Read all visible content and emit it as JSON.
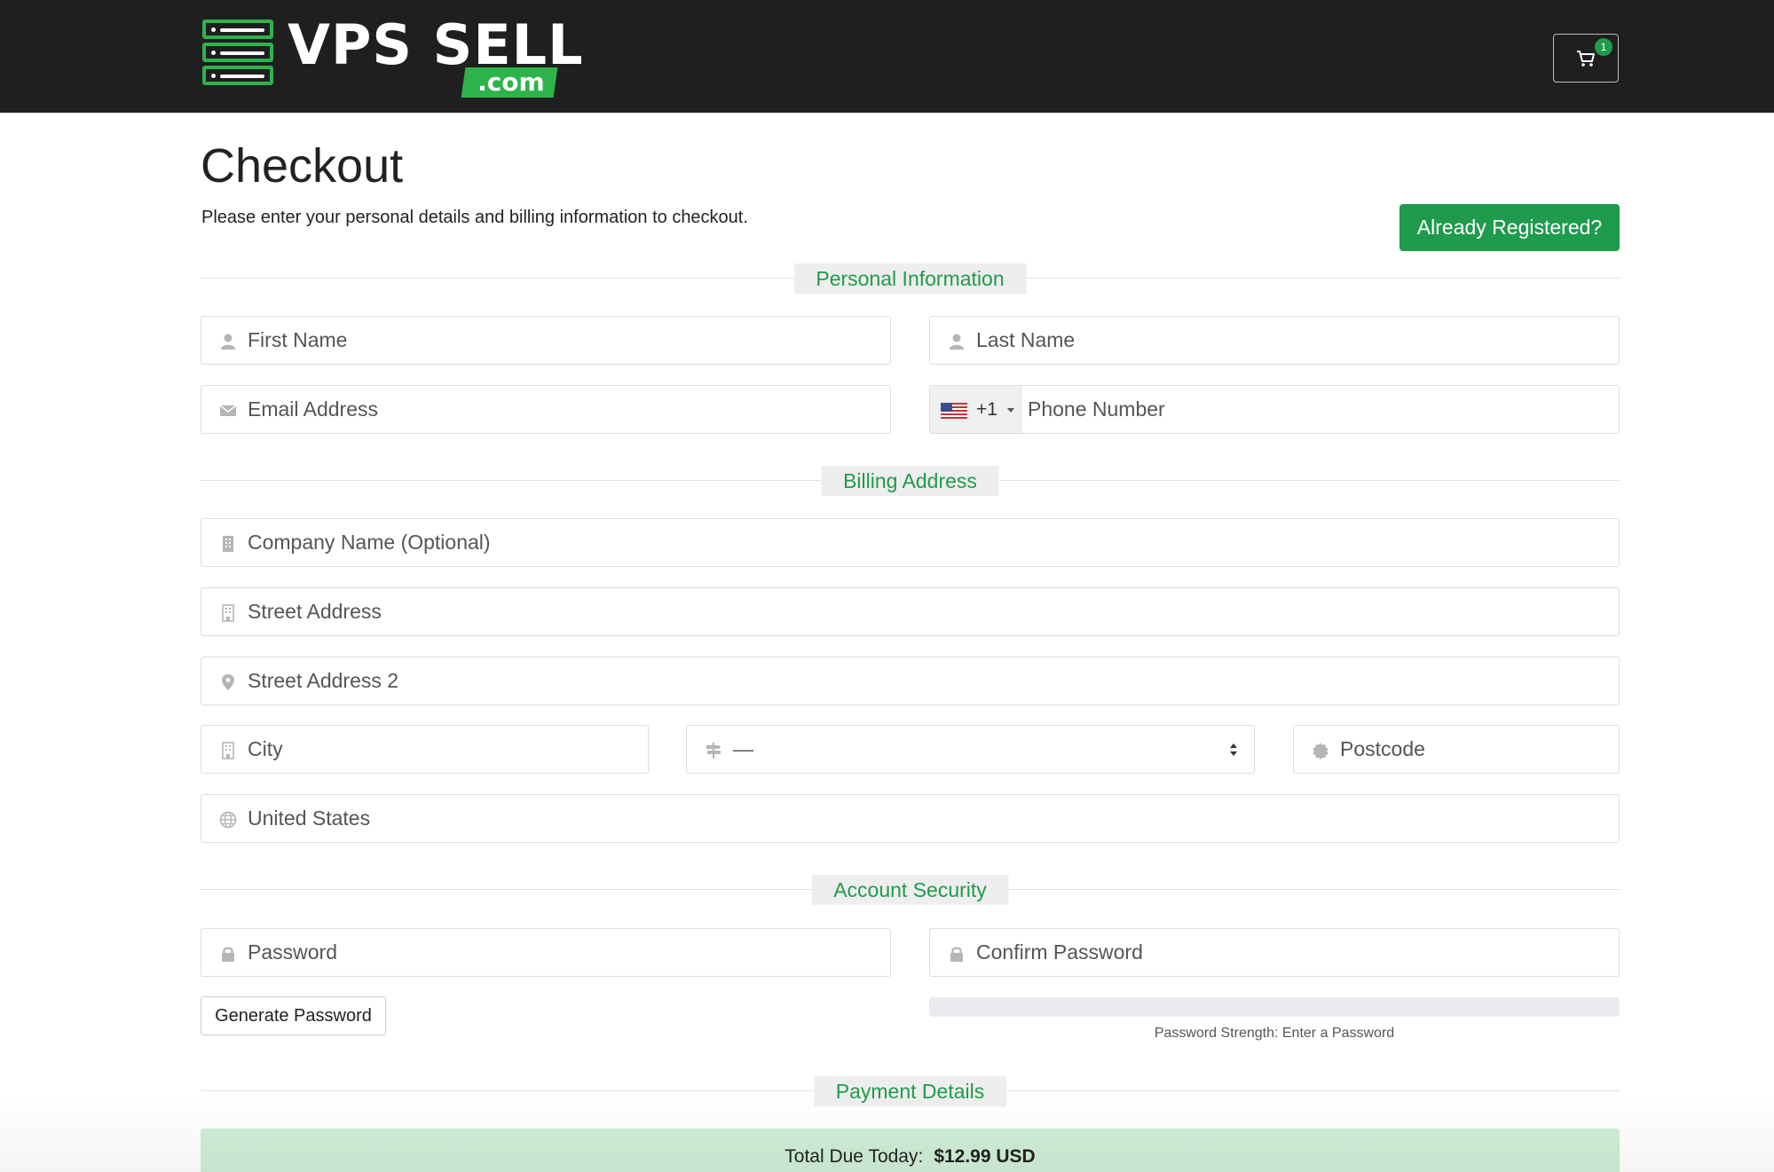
{
  "header": {
    "logo_main": "VPS SELL",
    "logo_suffix": ".com",
    "cart_count": "1"
  },
  "page": {
    "title": "Checkout",
    "subtitle": "Please enter your personal details and billing information to checkout.",
    "already_registered_label": "Already Registered?"
  },
  "sections": {
    "personal": "Personal Information",
    "billing": "Billing Address",
    "security": "Account Security",
    "payment": "Payment Details"
  },
  "personal": {
    "first_name_placeholder": "First Name",
    "last_name_placeholder": "Last Name",
    "email_placeholder": "Email Address",
    "phone_country_code": "+1",
    "phone_placeholder": "Phone Number"
  },
  "billing": {
    "company_placeholder": "Company Name (Optional)",
    "street_placeholder": "Street Address",
    "street2_placeholder": "Street Address 2",
    "city_placeholder": "City",
    "state_value": "—",
    "postcode_placeholder": "Postcode",
    "country_value": "United States"
  },
  "security": {
    "password_placeholder": "Password",
    "confirm_placeholder": "Confirm Password",
    "generate_label": "Generate Password",
    "strength_text": "Password Strength: Enter a Password"
  },
  "payment": {
    "total_label": "Total Due Today:",
    "total_amount": "$12.99 USD"
  },
  "colors": {
    "brand_green": "#1f9b4b",
    "header_bg": "#1f1f1f"
  },
  "icons": {
    "cart": "cart-icon",
    "user": "user-icon",
    "email": "envelope-icon",
    "building": "building-icon",
    "map_marker": "map-marker-icon",
    "state": "signpost-icon",
    "postcode": "certificate-icon",
    "country": "globe-icon",
    "lock": "lock-icon"
  }
}
